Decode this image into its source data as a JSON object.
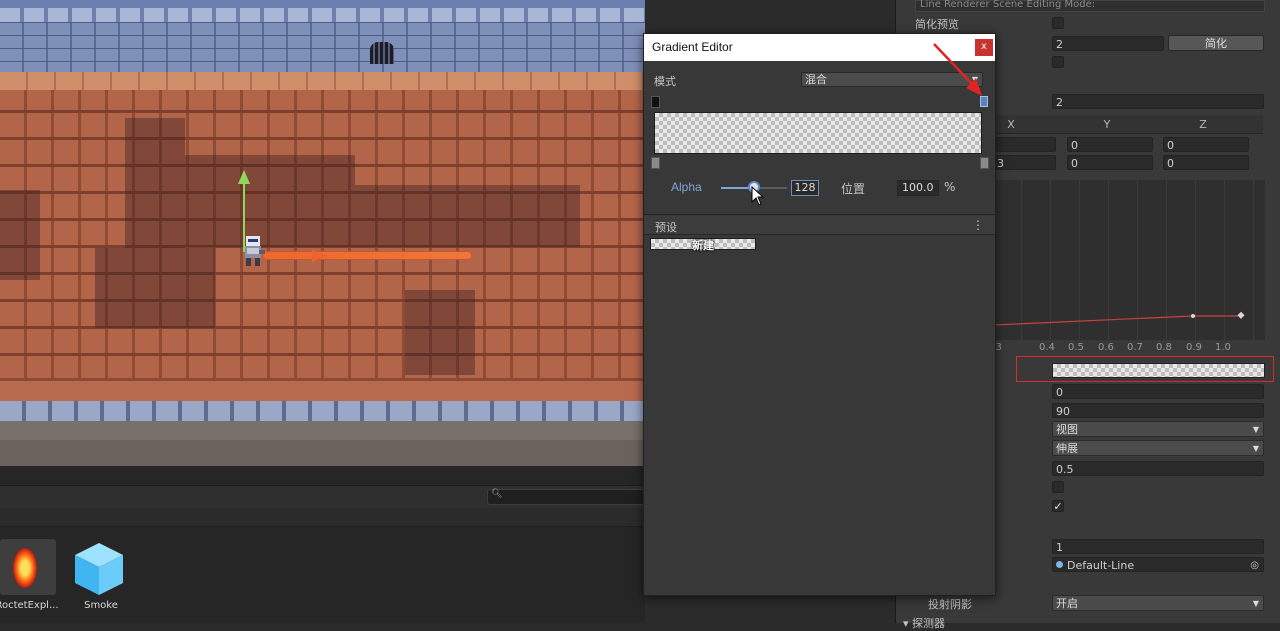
{
  "gradient_editor": {
    "title": "Gradient Editor",
    "close_label": "x",
    "mode_label": "模式",
    "mode_value": "混合",
    "alpha_label": "Alpha",
    "alpha_value": "128",
    "alpha_fraction": 0.5,
    "location_label": "位置",
    "location_value": "100.0",
    "percent_sign": "%",
    "presets_label": "预设",
    "presets_menu_glyph": "⋮",
    "new_preset_label": "新建",
    "selected_key_color": "#5e83b6"
  },
  "inspector": {
    "top_text": "Line Renderer Scene Editing Mode:",
    "simplify_preview_label": "简化预览",
    "simplify_tolerance_value": "2",
    "simplify_button_label": "简化",
    "positions_size_value": "2",
    "axis_headers": [
      "X",
      "Y",
      "Z"
    ],
    "row1": {
      "x": "",
      "y": "0",
      "z": "0"
    },
    "row2": {
      "x": "3",
      "y": "0",
      "z": "0"
    },
    "curve_ticks": [
      "0.3",
      "0.4",
      "0.5",
      "0.6",
      "0.7",
      "0.8",
      "0.9",
      "1.0"
    ],
    "corner_vertices_value": "0",
    "end_cap_vertices_value": "90",
    "alignment_value": "视图",
    "texture_mode_value": "伸展",
    "shadow_bias_value": "0.5",
    "checkbox_2_checked": true,
    "sorting_order_value": "1",
    "material_value": "Default-Line",
    "cast_shadows_label": "投射阴影",
    "cast_shadows_value": "开启",
    "section_label": "探测器",
    "accent_red": "#d92b2b",
    "curve_color": "#c9423a"
  },
  "project": {
    "search_icon": "search-icon",
    "assets": [
      {
        "name": "RoctetExpl...",
        "icon": "explosion-prefab-icon"
      },
      {
        "name": "Smoke",
        "icon": "prefab-cube-icon"
      }
    ]
  }
}
